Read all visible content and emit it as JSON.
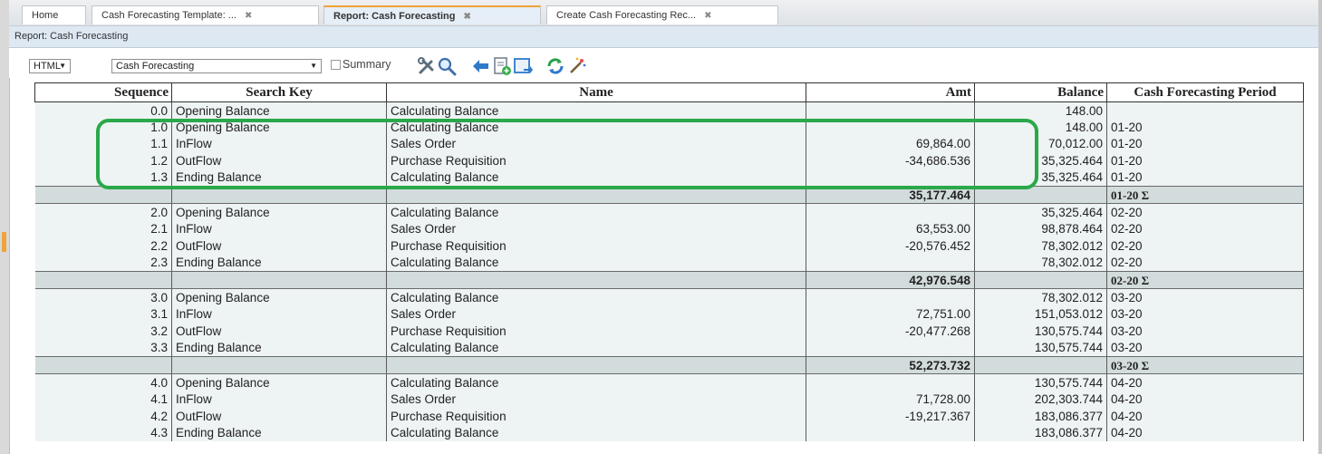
{
  "tabs": [
    {
      "label": "Home",
      "close": ""
    },
    {
      "label": "Cash Forecasting Template: ...",
      "close": "✖"
    },
    {
      "label": "Report: Cash Forecasting",
      "close": "✖"
    },
    {
      "label": "Create Cash Forecasting Rec...",
      "close": "✖"
    }
  ],
  "breadcrumb": "Report: Cash Forecasting",
  "toolbar": {
    "format_select": "HTML",
    "report_select": "Cash Forecasting",
    "summary_label": "Summary"
  },
  "table": {
    "columns": [
      "Sequence",
      "Search Key",
      "Name",
      "Amt",
      "Balance",
      "Cash Forecasting Period"
    ],
    "rows": [
      {
        "type": "data",
        "cells": [
          "0.0",
          "Opening Balance",
          "Calculating Balance",
          "",
          "148.00",
          ""
        ]
      },
      {
        "type": "data",
        "cells": [
          "1.0",
          "Opening Balance",
          "Calculating Balance",
          "",
          "148.00",
          "01-20"
        ]
      },
      {
        "type": "data",
        "cells": [
          "1.1",
          "InFlow",
          "Sales Order",
          "69,864.00",
          "70,012.00",
          "01-20"
        ]
      },
      {
        "type": "data",
        "cells": [
          "1.2",
          "OutFlow",
          "Purchase Requisition",
          "-34,686.536",
          "35,325.464",
          "01-20"
        ]
      },
      {
        "type": "data",
        "cells": [
          "1.3",
          "Ending Balance",
          "Calculating Balance",
          "",
          "35,325.464",
          "01-20"
        ]
      },
      {
        "type": "sum",
        "cells": [
          "",
          "",
          "",
          "35,177.464",
          "",
          "01-20 Σ"
        ]
      },
      {
        "type": "data",
        "cells": [
          "2.0",
          "Opening Balance",
          "Calculating Balance",
          "",
          "35,325.464",
          "02-20"
        ]
      },
      {
        "type": "data",
        "cells": [
          "2.1",
          "InFlow",
          "Sales Order",
          "63,553.00",
          "98,878.464",
          "02-20"
        ]
      },
      {
        "type": "data",
        "cells": [
          "2.2",
          "OutFlow",
          "Purchase Requisition",
          "-20,576.452",
          "78,302.012",
          "02-20"
        ]
      },
      {
        "type": "data",
        "cells": [
          "2.3",
          "Ending Balance",
          "Calculating Balance",
          "",
          "78,302.012",
          "02-20"
        ]
      },
      {
        "type": "sum",
        "cells": [
          "",
          "",
          "",
          "42,976.548",
          "",
          "02-20 Σ"
        ]
      },
      {
        "type": "data",
        "cells": [
          "3.0",
          "Opening Balance",
          "Calculating Balance",
          "",
          "78,302.012",
          "03-20"
        ]
      },
      {
        "type": "data",
        "cells": [
          "3.1",
          "InFlow",
          "Sales Order",
          "72,751.00",
          "151,053.012",
          "03-20"
        ]
      },
      {
        "type": "data",
        "cells": [
          "3.2",
          "OutFlow",
          "Purchase Requisition",
          "-20,477.268",
          "130,575.744",
          "03-20"
        ]
      },
      {
        "type": "data",
        "cells": [
          "3.3",
          "Ending Balance",
          "Calculating Balance",
          "",
          "130,575.744",
          "03-20"
        ]
      },
      {
        "type": "sum",
        "cells": [
          "",
          "",
          "",
          "52,273.732",
          "",
          "03-20 Σ"
        ]
      },
      {
        "type": "data",
        "cells": [
          "4.0",
          "Opening Balance",
          "Calculating Balance",
          "",
          "130,575.744",
          "04-20"
        ]
      },
      {
        "type": "data",
        "cells": [
          "4.1",
          "InFlow",
          "Sales Order",
          "71,728.00",
          "202,303.744",
          "04-20"
        ]
      },
      {
        "type": "data",
        "cells": [
          "4.2",
          "OutFlow",
          "Purchase Requisition",
          "-19,217.367",
          "183,086.377",
          "04-20"
        ]
      },
      {
        "type": "data",
        "cells": [
          "4.3",
          "Ending Balance",
          "Calculating Balance",
          "",
          "183,086.377",
          "04-20"
        ]
      }
    ]
  },
  "colors": {
    "highlight": "#2aa84a",
    "active_tab_accent": "#f0a33a"
  }
}
